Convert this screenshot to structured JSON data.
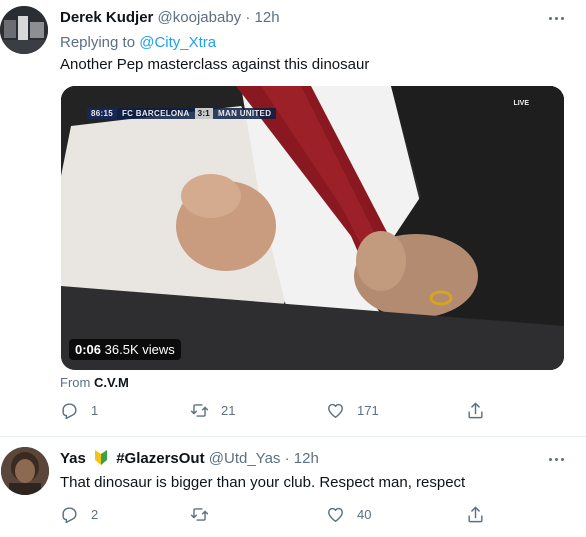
{
  "tweets": [
    {
      "name": "Derek Kudjer",
      "handle": "@koojababy",
      "sep": "·",
      "time": "12h",
      "replying_label": "Replying to",
      "replying_to": "@City_Xtra",
      "text": "Another Pep masterclass against this dinosaur",
      "video": {
        "clock": "86:15",
        "home": "FC BARCELONA",
        "score": "3:1",
        "away": "MAN UNITED",
        "broadcaster": "LIVE",
        "duration": "0:06",
        "views": "36.5K views"
      },
      "from_label": "From",
      "from_source": "C.V.M",
      "actions": {
        "replies": "1",
        "retweets": "21",
        "likes": "171"
      }
    },
    {
      "name": "Yas",
      "hashtag": "#GlazersOut",
      "handle": "@Utd_Yas",
      "sep": "·",
      "time": "12h",
      "text": "That dinosaur is bigger than your club. Respect man, respect",
      "actions": {
        "replies": "2",
        "retweets": "",
        "likes": "40"
      }
    }
  ],
  "icons": {
    "more": "more-icon",
    "reply": "reply-icon",
    "retweet": "retweet-icon",
    "like": "heart-icon",
    "share": "share-icon",
    "badge": "beginner-badge-icon"
  },
  "colors": {
    "link": "#1da1f2",
    "muted": "#5b7083",
    "text": "#0f1419"
  }
}
